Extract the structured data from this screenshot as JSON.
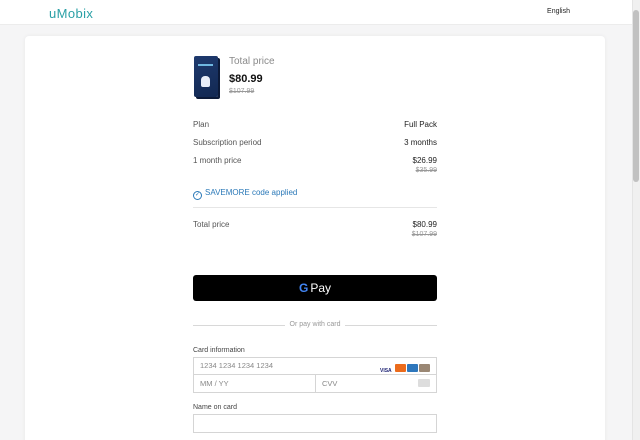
{
  "header": {
    "logo": "uMobix",
    "language": "English"
  },
  "summary": {
    "title": "Total price",
    "price": "$80.99",
    "old_price": "$107.99"
  },
  "details": {
    "plan_label": "Plan",
    "plan_value": "Full Pack",
    "period_label": "Subscription period",
    "period_value": "3 months",
    "month_label": "1 month price",
    "month_value": "$26.99",
    "month_old": "$35.99"
  },
  "promo": {
    "text": "SAVEMORE code applied"
  },
  "total": {
    "label": "Total price",
    "value": "$80.99",
    "old": "$107.99"
  },
  "gpay": {
    "g": "G",
    "label": "Pay"
  },
  "divider_text": "Or pay with card",
  "card_form": {
    "card_info_label": "Card information",
    "card_number_placeholder": "1234 1234 1234 1234",
    "expiry_placeholder": "MM / YY",
    "cvv_placeholder": "CVV",
    "name_label": "Name on card",
    "visa_text": "VISA"
  }
}
